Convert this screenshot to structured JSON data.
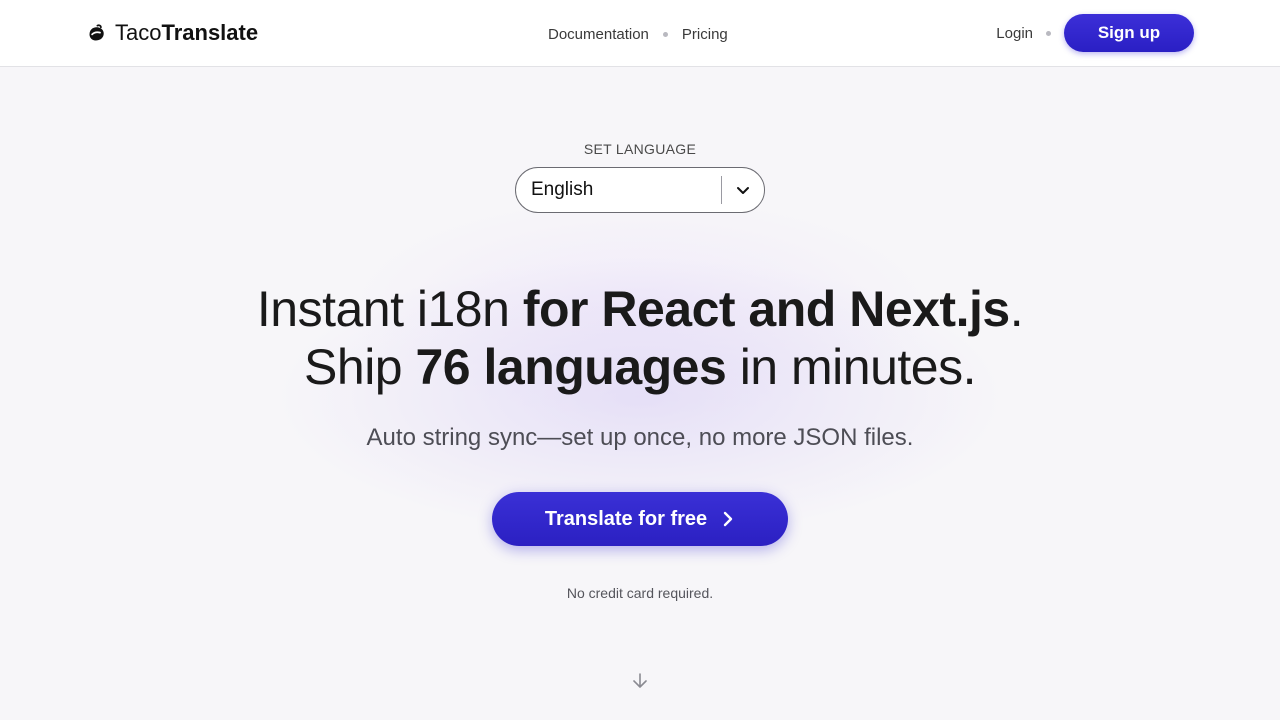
{
  "brand": {
    "name_light": "Taco",
    "name_bold": "Translate",
    "icon": "taco-logo-icon"
  },
  "nav": {
    "documentation": "Documentation",
    "pricing": "Pricing",
    "login": "Login",
    "signup": "Sign up"
  },
  "language": {
    "label": "SET LANGUAGE",
    "selected": "English"
  },
  "hero": {
    "line1_light": "Instant i18n ",
    "line1_bold": "for React and Next.js",
    "line1_end": ".",
    "line2_start": "Ship ",
    "line2_bold": "76 languages",
    "line2_end": " in minutes.",
    "subtitle": "Auto string sync—set up once, no more JSON files.",
    "cta": "Translate for free",
    "note": "No credit card required."
  },
  "colors": {
    "accent": "#3a30d6",
    "background": "#f7f6f9"
  }
}
